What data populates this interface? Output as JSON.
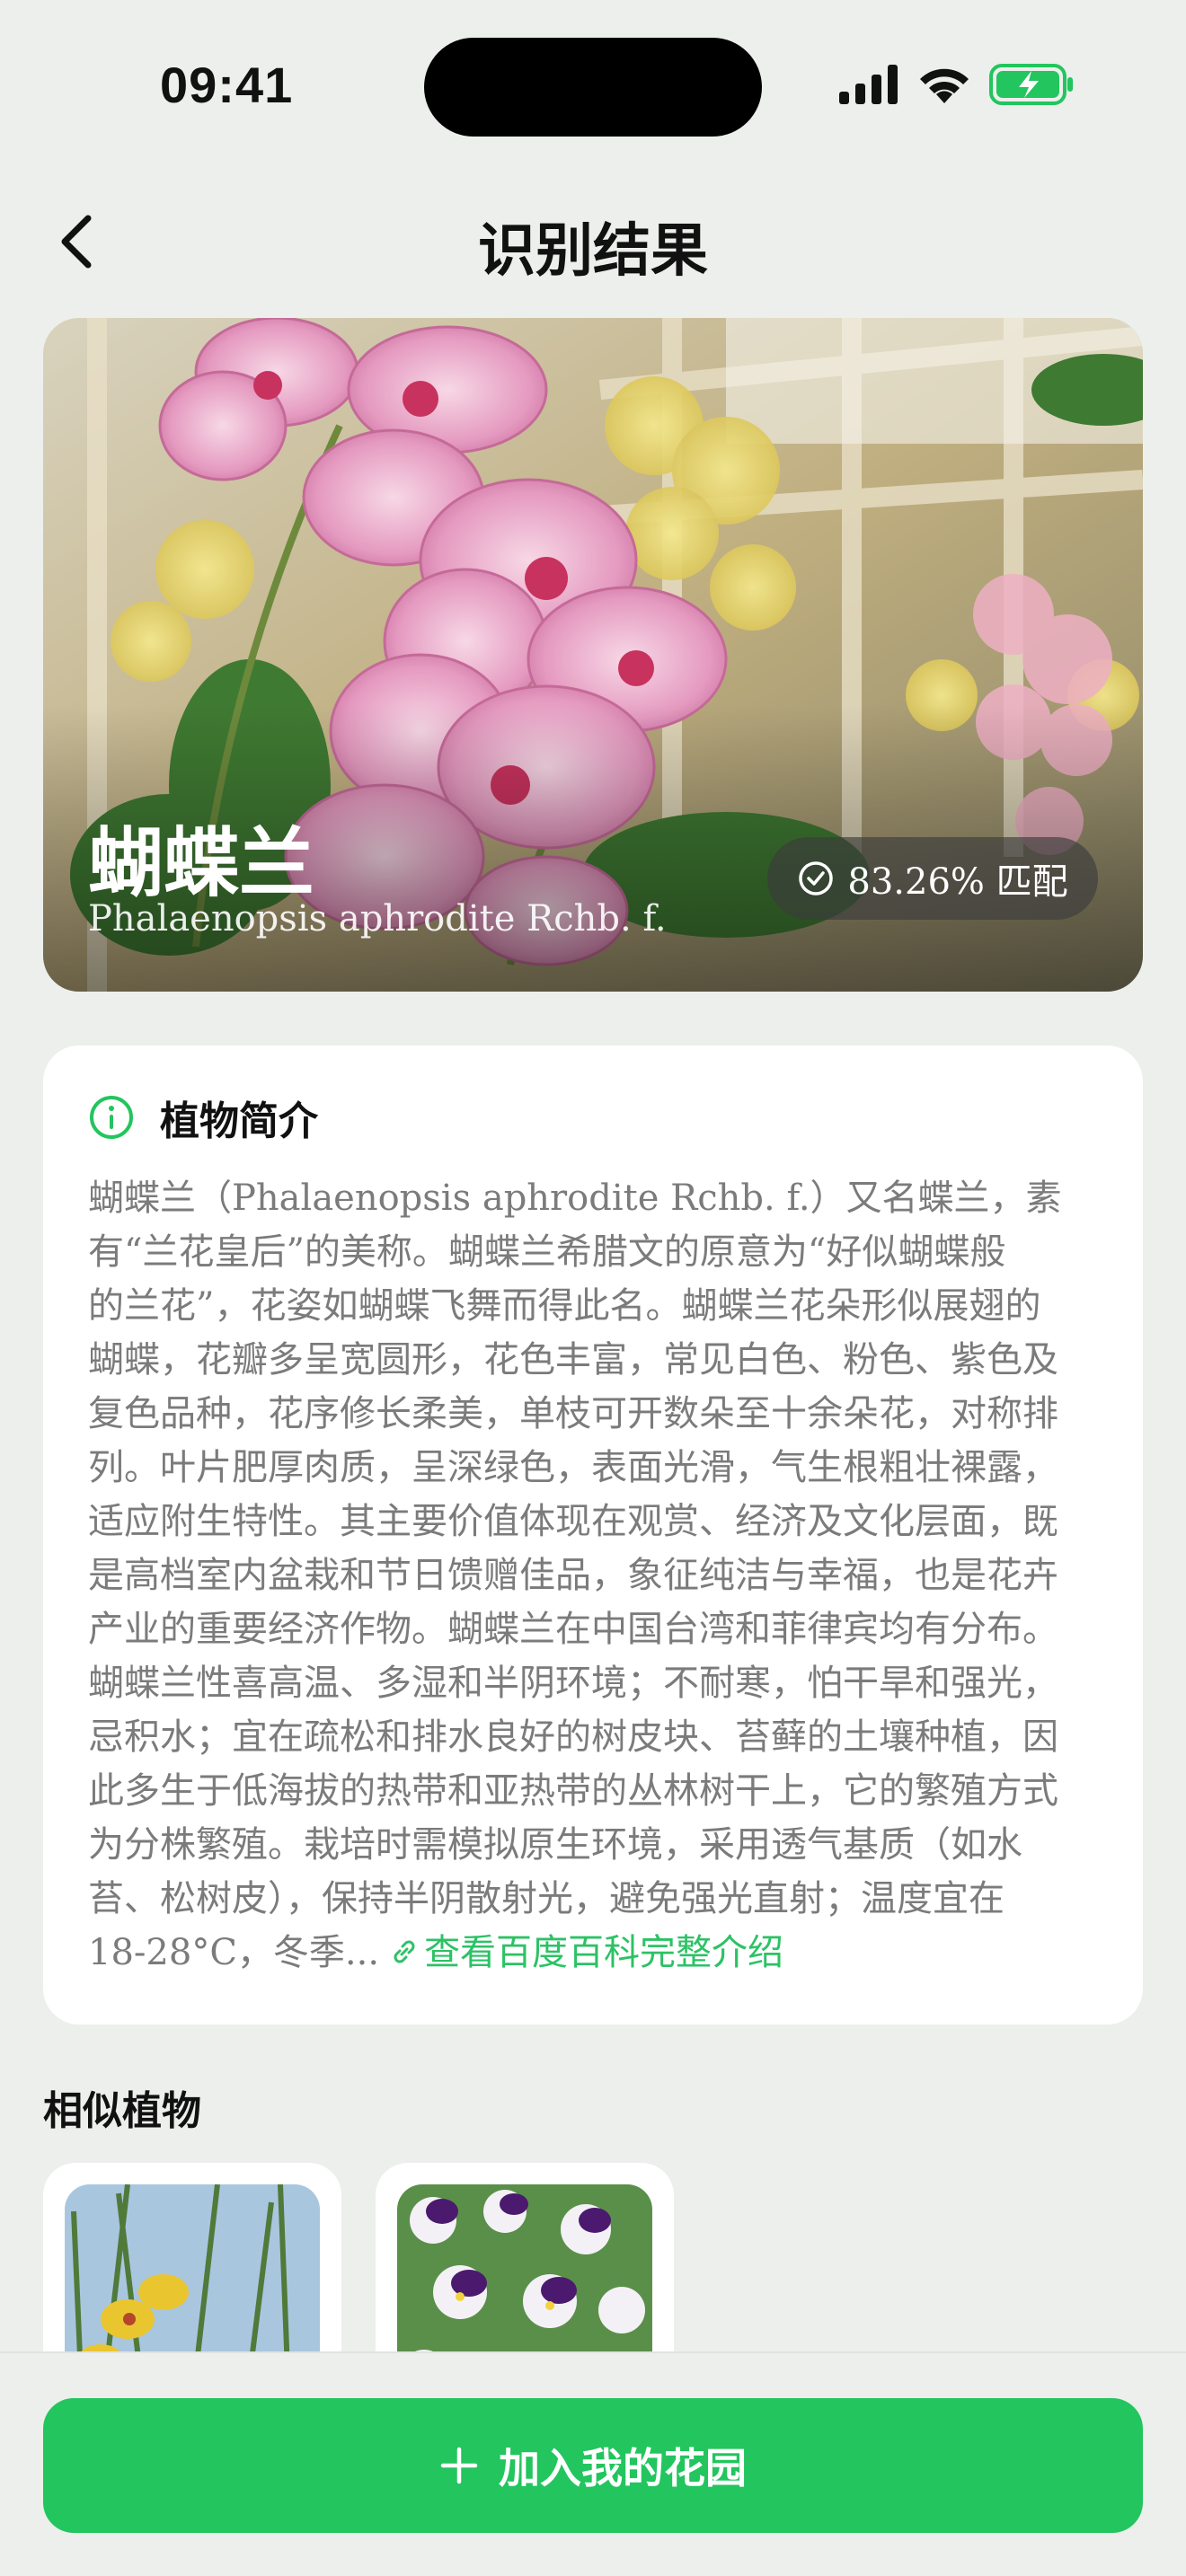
{
  "status_bar": {
    "time": "09:41",
    "icons": [
      "signal-icon",
      "wifi-icon",
      "battery-charging-icon"
    ],
    "battery_color": "#22c55e"
  },
  "nav": {
    "title": "识别结果",
    "back_icon": "chevron-left-icon"
  },
  "result": {
    "name": "蝴蝶兰",
    "latin_name": "Phalaenopsis aphrodite Rchb. f.",
    "match_text": "83.26% 匹配",
    "match_icon": "check-circle-icon"
  },
  "intro": {
    "title": "植物简介",
    "icon": "info-circle-icon",
    "lines": [
      "蝴蝶兰（Phalaenopsis aphrodite Rchb. f.）又名蝶兰，素",
      "有“兰花皇后”的美称。蝴蝶兰希腊文的原意为“好似蝴蝶般",
      "的兰花”，花姿如蝴蝶飞舞而得此名。蝴蝶兰花朵形似展翅的",
      "蝴蝶，花瓣多呈宽圆形，花色丰富，常见白色、粉色、紫色及",
      "复色品种，花序修长柔美，单枝可开数朵至十余朵花，对称排",
      "列。叶片肥厚肉质，呈深绿色，表面光滑，气生根粗壮裸露，",
      "适应附生特性。其主要价值体现在观赏、经济及文化层面，既",
      "是高档室内盆栽和节日馈赠佳品，象征纯洁与幸福，也是花卉",
      "产业的重要经济作物。蝴蝶兰在中国台湾和菲律宾均有分布。",
      "蝴蝶兰性喜高温、多湿和半阴环境；不耐寒，怕干旱和强光，",
      "忌积水；宜在疏松和排水良好的树皮块、苔藓的土壤种植，因",
      "此多生于低海拔的热带和亚热带的丛林树干上，它的繁殖方式",
      "为分株繁殖。栽培时需模拟原生环境，采用透气基质（如水",
      "苔、松树皮），保持半阴散射光，避免强光直射；温度宜在"
    ],
    "last_line": "18-28°C，冬季...",
    "more_link": "查看百度百科完整介绍",
    "link_color": "#2cc265"
  },
  "similar": {
    "title": "相似植物",
    "items": [
      {
        "image": "yellow-orchid-photo"
      },
      {
        "image": "purple-pansy-photo"
      }
    ]
  },
  "cta": {
    "label": "加入我的花园",
    "icon": "plus-icon",
    "color": "#22c55e"
  }
}
